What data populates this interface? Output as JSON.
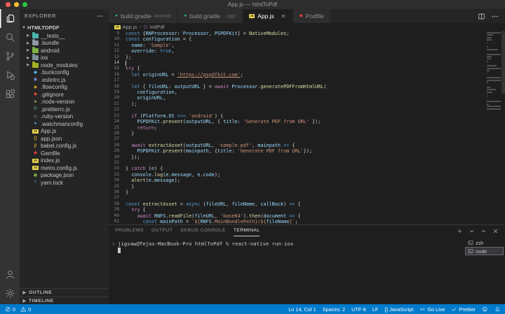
{
  "window": {
    "title": "App.js — htmlToPdf"
  },
  "activity_bar": {
    "top": [
      {
        "name": "explorer",
        "icon": "files",
        "active": true
      },
      {
        "name": "search",
        "icon": "search",
        "active": false
      },
      {
        "name": "source-control",
        "icon": "source-control",
        "active": false
      },
      {
        "name": "run-and-debug",
        "icon": "debug",
        "active": false
      },
      {
        "name": "extensions",
        "icon": "extensions",
        "active": false
      }
    ],
    "bottom": [
      {
        "name": "accounts",
        "icon": "account",
        "active": false
      },
      {
        "name": "manage",
        "icon": "settings",
        "active": false
      }
    ]
  },
  "sidebar": {
    "header": "EXPLORER",
    "root": "HTMLTOPDF",
    "tree": [
      {
        "label": "__tests__",
        "kind": "folder",
        "color": "#4db6ac"
      },
      {
        "label": ".bundle",
        "kind": "folder",
        "color": "#8d9ba3"
      },
      {
        "label": "android",
        "kind": "folder",
        "color": "#7cb342"
      },
      {
        "label": "ios",
        "kind": "folder",
        "color": "#7a8f9a"
      },
      {
        "label": "node_modules",
        "kind": "folder",
        "color": "#a4b425"
      },
      {
        "label": ".buckconfig",
        "kind": "file",
        "glyph": "◆",
        "color": "#4fc3f7"
      },
      {
        "label": ".eslintrc.js",
        "kind": "file",
        "glyph": "◉",
        "color": "#7986cb"
      },
      {
        "label": ".flowconfig",
        "kind": "file",
        "glyph": "◈",
        "color": "#fbc02d"
      },
      {
        "label": ".gitignore",
        "kind": "file",
        "glyph": "◆",
        "color": "#e64a33"
      },
      {
        "label": ".node-version",
        "kind": "file",
        "glyph": "●",
        "color": "#8bc34a"
      },
      {
        "label": ".prettierrc.js",
        "kind": "file",
        "glyph": "P",
        "color": "#56b3b4"
      },
      {
        "label": ".ruby-version",
        "kind": "file",
        "glyph": "◇",
        "color": "#b0bec5"
      },
      {
        "label": ".watchmanconfig",
        "kind": "file",
        "glyph": "●",
        "color": "#42a5f5"
      },
      {
        "label": "App.js",
        "kind": "file",
        "glyph": "JS",
        "color": "#f0dc4e"
      },
      {
        "label": "app.json",
        "kind": "file",
        "glyph": "{}",
        "color": "#fbc02d"
      },
      {
        "label": "babel.config.js",
        "kind": "file",
        "glyph": "β",
        "color": "#fbc02d"
      },
      {
        "label": "Gemfile",
        "kind": "file",
        "glyph": "◆",
        "color": "#e53935"
      },
      {
        "label": "index.js",
        "kind": "file",
        "glyph": "JS",
        "color": "#f0dc4e"
      },
      {
        "label": "metro.config.js",
        "kind": "file",
        "glyph": "JS",
        "color": "#f0dc4e"
      },
      {
        "label": "package.json",
        "kind": "file",
        "glyph": "◉",
        "color": "#8bc34a"
      },
      {
        "label": "yarn.lock",
        "kind": "file",
        "glyph": "Y",
        "color": "#2c8ebb"
      }
    ],
    "sections": [
      "OUTLINE",
      "TIMELINE"
    ]
  },
  "tabs": [
    {
      "label": "build.gradle",
      "suffix": "android",
      "icon": "gradle",
      "glyph": "●",
      "glyph_color": "#23b5a8",
      "active": false
    },
    {
      "label": "build.gradle",
      "suffix": "...app",
      "icon": "gradle",
      "glyph": "●",
      "glyph_color": "#23b5a8",
      "active": false
    },
    {
      "label": "App.js",
      "suffix": "",
      "icon": "javascript",
      "glyph": "JS",
      "glyph_color": "#f0dc4e",
      "active": true,
      "closable": true
    },
    {
      "label": "Podfile",
      "suffix": "",
      "icon": "ruby",
      "glyph": "◆",
      "glyph_color": "#e53935",
      "active": false
    }
  ],
  "breadcrumb": {
    "file": "App.js",
    "file_glyph": "JS",
    "file_glyph_color": "#f0dc4e",
    "symbol": "initPdf",
    "symbol_color": "#b180d7"
  },
  "editor": {
    "cursor_line": 14,
    "lines": [
      {
        "n": 9,
        "seg": [
          [
            "k",
            "const "
          ],
          [
            "p",
            "{"
          ],
          [
            "v",
            "RNProcessor"
          ],
          [
            "p",
            ": "
          ],
          [
            "v",
            "Processor"
          ],
          [
            "p",
            ", "
          ],
          [
            "v",
            "PSPDFKit"
          ],
          [
            "p",
            "} = "
          ],
          [
            "f",
            "NativeModules"
          ],
          [
            "p",
            ";"
          ]
        ]
      },
      {
        "n": 10,
        "seg": [
          [
            "k",
            "const "
          ],
          [
            "v",
            "configuration"
          ],
          [
            "p",
            " = {"
          ]
        ]
      },
      {
        "n": 11,
        "seg": [
          [
            "p",
            "  "
          ],
          [
            "v",
            "name"
          ],
          [
            "p",
            ": "
          ],
          [
            "s",
            "'Sample'"
          ],
          [
            "p",
            ","
          ]
        ]
      },
      {
        "n": 12,
        "seg": [
          [
            "p",
            "  "
          ],
          [
            "v",
            "override"
          ],
          [
            "p",
            ": "
          ],
          [
            "n",
            "true"
          ],
          [
            "p",
            ","
          ]
        ]
      },
      {
        "n": 13,
        "seg": [
          [
            "p",
            "};"
          ]
        ]
      },
      {
        "n": 14,
        "seg": []
      },
      {
        "n": 15,
        "seg": [
          [
            "c",
            "try"
          ],
          [
            "p",
            " {"
          ]
        ]
      },
      {
        "n": 16,
        "seg": [
          [
            "p",
            "  "
          ],
          [
            "k",
            "let "
          ],
          [
            "v",
            "originURL"
          ],
          [
            "p",
            " = "
          ],
          [
            "u",
            "'https://pspdfkit.com'"
          ],
          [
            "p",
            ";"
          ]
        ]
      },
      {
        "n": 17,
        "seg": []
      },
      {
        "n": 18,
        "seg": [
          [
            "p",
            "  "
          ],
          [
            "k",
            "let "
          ],
          [
            "p",
            "{ "
          ],
          [
            "v",
            "fileURL"
          ],
          [
            "p",
            ": "
          ],
          [
            "v",
            "outputURL"
          ],
          [
            "p",
            " } = "
          ],
          [
            "c",
            "await "
          ],
          [
            "v",
            "Processor"
          ],
          [
            "p",
            "."
          ],
          [
            "f",
            "generatePDFFromHtmlURL"
          ],
          [
            "p",
            "("
          ]
        ]
      },
      {
        "n": 19,
        "seg": [
          [
            "p",
            "    "
          ],
          [
            "v",
            "configuration"
          ],
          [
            "p",
            ","
          ]
        ]
      },
      {
        "n": 20,
        "seg": [
          [
            "p",
            "    "
          ],
          [
            "v",
            "originURL"
          ],
          [
            "p",
            ","
          ]
        ]
      },
      {
        "n": 21,
        "seg": [
          [
            "p",
            "  );"
          ]
        ]
      },
      {
        "n": 22,
        "seg": []
      },
      {
        "n": 23,
        "seg": [
          [
            "p",
            "  "
          ],
          [
            "c",
            "if"
          ],
          [
            "p",
            " ("
          ],
          [
            "v",
            "Platform"
          ],
          [
            "p",
            "."
          ],
          [
            "v",
            "OS"
          ],
          [
            "p",
            " "
          ],
          [
            "k",
            "==="
          ],
          [
            "p",
            " "
          ],
          [
            "s",
            "'android'"
          ],
          [
            "p",
            ") {"
          ]
        ]
      },
      {
        "n": 24,
        "seg": [
          [
            "p",
            "    "
          ],
          [
            "v",
            "PSPDFKit"
          ],
          [
            "p",
            "."
          ],
          [
            "f",
            "present"
          ],
          [
            "p",
            "("
          ],
          [
            "v",
            "outputURL"
          ],
          [
            "p",
            ", { "
          ],
          [
            "v",
            "title"
          ],
          [
            "p",
            ": "
          ],
          [
            "s",
            "'Generate PDF from URL'"
          ],
          [
            "p",
            " });"
          ]
        ]
      },
      {
        "n": 25,
        "seg": [
          [
            "p",
            "    "
          ],
          [
            "c",
            "return"
          ],
          [
            "p",
            ";"
          ]
        ]
      },
      {
        "n": 26,
        "seg": [
          [
            "p",
            "  }"
          ]
        ]
      },
      {
        "n": 27,
        "seg": []
      },
      {
        "n": 28,
        "seg": [
          [
            "p",
            "  "
          ],
          [
            "c",
            "await "
          ],
          [
            "f",
            "extractAsset"
          ],
          [
            "p",
            "("
          ],
          [
            "v",
            "outputURL"
          ],
          [
            "p",
            ", "
          ],
          [
            "s",
            "'sample.pdf'"
          ],
          [
            "p",
            ", "
          ],
          [
            "v",
            "mainpath"
          ],
          [
            "p",
            " "
          ],
          [
            "k",
            "=>"
          ],
          [
            "p",
            " {"
          ]
        ]
      },
      {
        "n": 29,
        "seg": [
          [
            "p",
            "    "
          ],
          [
            "v",
            "PSPDFKit"
          ],
          [
            "p",
            "."
          ],
          [
            "f",
            "present"
          ],
          [
            "p",
            "("
          ],
          [
            "v",
            "mainpath"
          ],
          [
            "p",
            ", {"
          ],
          [
            "v",
            "title"
          ],
          [
            "p",
            ": "
          ],
          [
            "s",
            "'Generate PDF from URL'"
          ],
          [
            "p",
            "});"
          ]
        ]
      },
      {
        "n": 30,
        "seg": [
          [
            "p",
            "  });"
          ]
        ]
      },
      {
        "n": 31,
        "seg": []
      },
      {
        "n": 32,
        "seg": [
          [
            "p",
            "} "
          ],
          [
            "c",
            "catch"
          ],
          [
            "p",
            " ("
          ],
          [
            "v",
            "e"
          ],
          [
            "p",
            ") {"
          ]
        ]
      },
      {
        "n": 33,
        "seg": [
          [
            "p",
            "  "
          ],
          [
            "v",
            "console"
          ],
          [
            "p",
            "."
          ],
          [
            "f",
            "log"
          ],
          [
            "p",
            "("
          ],
          [
            "v",
            "e"
          ],
          [
            "p",
            "."
          ],
          [
            "v",
            "message"
          ],
          [
            "p",
            ", "
          ],
          [
            "v",
            "e"
          ],
          [
            "p",
            "."
          ],
          [
            "v",
            "code"
          ],
          [
            "p",
            ");"
          ]
        ]
      },
      {
        "n": 34,
        "seg": [
          [
            "p",
            "  "
          ],
          [
            "f",
            "alert"
          ],
          [
            "p",
            "("
          ],
          [
            "v",
            "e"
          ],
          [
            "p",
            "."
          ],
          [
            "v",
            "message"
          ],
          [
            "p",
            ");"
          ]
        ]
      },
      {
        "n": 35,
        "seg": [
          [
            "p",
            "  }"
          ]
        ]
      },
      {
        "n": 36,
        "seg": [
          [
            "p",
            "}"
          ]
        ]
      },
      {
        "n": 37,
        "seg": []
      },
      {
        "n": 38,
        "seg": [
          [
            "k",
            "const "
          ],
          [
            "f",
            "extractAsset"
          ],
          [
            "p",
            " = "
          ],
          [
            "k",
            "async"
          ],
          [
            "p",
            " ("
          ],
          [
            "v",
            "fileURL"
          ],
          [
            "p",
            ", "
          ],
          [
            "v",
            "fileName"
          ],
          [
            "p",
            ", "
          ],
          [
            "v",
            "callBack"
          ],
          [
            "p",
            ") "
          ],
          [
            "k",
            "=>"
          ],
          [
            "p",
            " {"
          ]
        ]
      },
      {
        "n": 39,
        "seg": [
          [
            "p",
            "  "
          ],
          [
            "c",
            "try"
          ],
          [
            "p",
            " {"
          ]
        ]
      },
      {
        "n": 40,
        "seg": [
          [
            "p",
            "    "
          ],
          [
            "c",
            "await "
          ],
          [
            "v",
            "RNFS"
          ],
          [
            "p",
            "."
          ],
          [
            "f",
            "readFile"
          ],
          [
            "p",
            "("
          ],
          [
            "v",
            "fileURL"
          ],
          [
            "p",
            ", "
          ],
          [
            "s",
            "'base64'"
          ],
          [
            "p",
            ")."
          ],
          [
            "f",
            "then"
          ],
          [
            "p",
            "("
          ],
          [
            "v",
            "document"
          ],
          [
            "p",
            " "
          ],
          [
            "k",
            "=>"
          ],
          [
            "p",
            " {"
          ]
        ]
      },
      {
        "n": 41,
        "seg": [
          [
            "p",
            "      "
          ],
          [
            "k",
            "const "
          ],
          [
            "v",
            "mainPath"
          ],
          [
            "p",
            " = "
          ],
          [
            "s",
            "`${"
          ],
          [
            "v",
            "RNFS"
          ],
          [
            "s",
            ".MainBundlePath}/${"
          ],
          [
            "v",
            "fileName"
          ],
          [
            "s",
            "}`"
          ],
          [
            "p",
            ";"
          ]
        ]
      }
    ]
  },
  "panel": {
    "tabs": [
      "PROBLEMS",
      "OUTPUT",
      "DEBUG CONSOLE",
      "TERMINAL"
    ],
    "active_tab": "TERMINAL",
    "terminal": {
      "decoration": "○",
      "prompt": "jigsaw@Tejas-MacBook-Pro htmlToPdf % react-native run-ios"
    },
    "terminal_list": [
      {
        "label": "zsh",
        "selected": false
      },
      {
        "label": "node",
        "selected": true
      }
    ]
  },
  "status_bar": {
    "left": [
      {
        "name": "errors",
        "icon": "circle-slash",
        "text": "0"
      },
      {
        "name": "warnings",
        "icon": "warning",
        "text": "0"
      }
    ],
    "right": [
      {
        "name": "cursor-position",
        "text": "Ln 14, Col 1"
      },
      {
        "name": "indentation",
        "text": "Spaces: 2"
      },
      {
        "name": "encoding",
        "text": "UTF-8"
      },
      {
        "name": "eol",
        "text": "LF"
      },
      {
        "name": "language-mode",
        "text": "{} JavaScript"
      },
      {
        "name": "go-live",
        "icon": "broadcast",
        "text": "Go Live"
      },
      {
        "name": "prettier",
        "icon": "check",
        "text": "Prettier"
      },
      {
        "name": "feedback",
        "icon": "smiley",
        "text": ""
      },
      {
        "name": "notifications",
        "icon": "bell",
        "text": ""
      }
    ]
  },
  "colors": {
    "status_bar": "#007acc",
    "traffic": [
      "#ff5f57",
      "#febc2e",
      "#28c840"
    ]
  }
}
